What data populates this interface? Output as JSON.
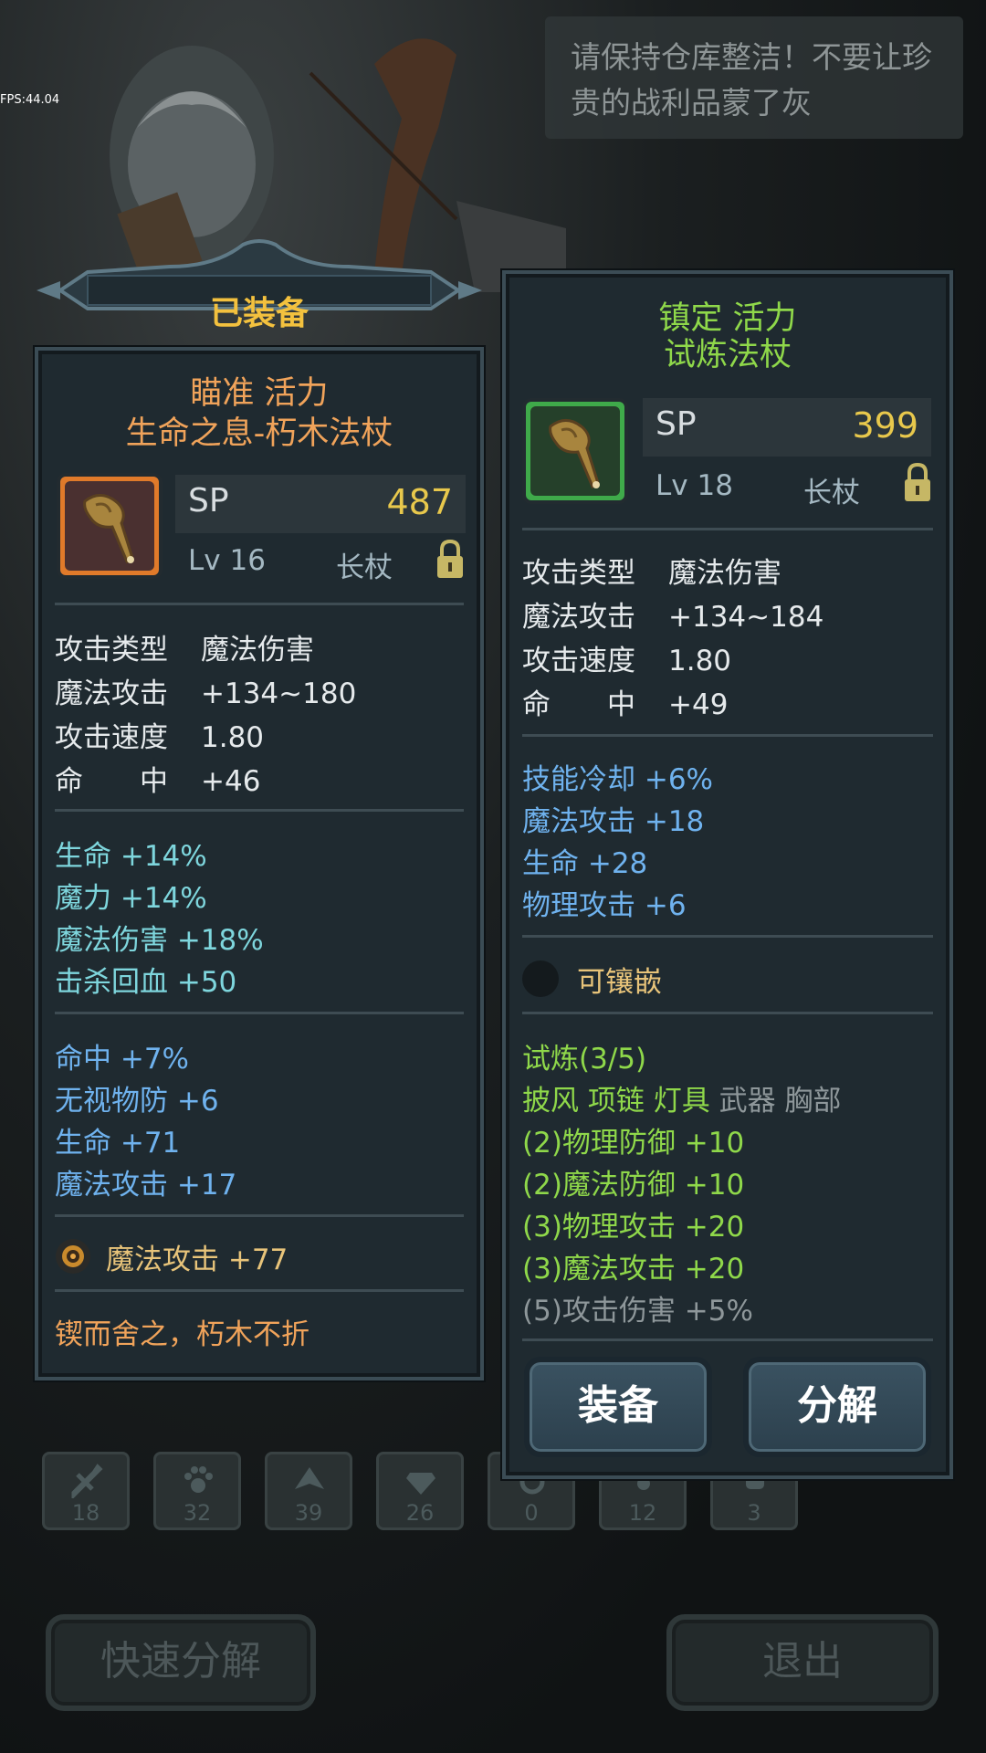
{
  "fps": "FPS:44.04",
  "tip_text": "请保持仓库整洁！不要让珍贵的战利品蒙了灰",
  "categories": [
    {
      "icon": "weapon-icon",
      "count": "18"
    },
    {
      "icon": "paw-icon",
      "count": "32"
    },
    {
      "icon": "armor-icon",
      "count": "39"
    },
    {
      "icon": "gem-icon",
      "count": "26"
    },
    {
      "icon": "ring-icon",
      "count": "0"
    },
    {
      "icon": "clover-icon",
      "count": "12"
    },
    {
      "icon": "misc-icon",
      "count": "3"
    }
  ],
  "bottom_buttons": {
    "quick_dismantle": "快速分解",
    "exit": "退出"
  },
  "equipped": {
    "banner": "已装备",
    "prefix": "瞄准 活力",
    "name": "生命之息-朽木法杖",
    "sp_label": "SP",
    "sp_value": "487",
    "level": "Lv 16",
    "type": "长杖",
    "base_stats": [
      {
        "k": "攻击类型",
        "v": "魔法伤害"
      },
      {
        "k": "魔法攻击",
        "v": "+134~180"
      },
      {
        "k": "攻击速度",
        "v": "1.80"
      },
      {
        "k": "命　　中",
        "v": "+46"
      }
    ],
    "bonus_a": [
      "生命 +14%",
      "魔力 +14%",
      "魔法伤害 +18%",
      "击杀回血 +50"
    ],
    "bonus_b": [
      "命中 +7%",
      "无视物防 +6",
      "生命 +71",
      "魔法攻击 +17"
    ],
    "socket": "魔法攻击 +77",
    "flavor": "锲而舍之，朽木不折"
  },
  "candidate": {
    "prefix": "镇定 活力",
    "name": "试炼法杖",
    "sp_label": "SP",
    "sp_value": "399",
    "level": "Lv 18",
    "type": "长杖",
    "base_stats": [
      {
        "k": "攻击类型",
        "v": "魔法伤害"
      },
      {
        "k": "魔法攻击",
        "v": "+134~184"
      },
      {
        "k": "攻击速度",
        "v": "1.80"
      },
      {
        "k": "命　　中",
        "v": "+49"
      }
    ],
    "bonus": [
      "技能冷却 +6%",
      "魔法攻击 +18",
      "生命 +28",
      "物理攻击 +6"
    ],
    "socket": "可镶嵌",
    "set_title": "试炼(3/5)",
    "set_parts_active": "披风 项链 灯具",
    "set_parts_inactive": "武器 胸部",
    "set_bonus_active": [
      "(2)物理防御 +10",
      "(2)魔法防御 +10",
      "(3)物理攻击 +20",
      "(3)魔法攻击 +20"
    ],
    "set_bonus_inactive": "(5)攻击伤害 +5%",
    "equip_button": "装备",
    "dismantle_button": "分解"
  },
  "colors": {
    "title_gold": "#f3c13e",
    "equipped_name": "#f0a35a",
    "candidate_name": "#8fd84a",
    "sp_value": "#e8c84c",
    "affix_cyan": "#7ed6dd",
    "affix_blue": "#6fb2ee"
  }
}
